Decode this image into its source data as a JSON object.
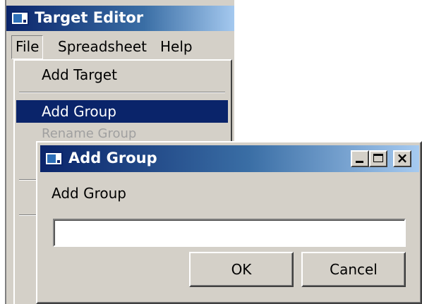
{
  "main_window": {
    "title": "Target Editor",
    "icon": "app-window-icon"
  },
  "menubar": {
    "items": [
      "File",
      "Spreadsheet",
      "Help"
    ]
  },
  "file_menu": {
    "items": [
      {
        "label": "Add Target",
        "state": "normal"
      },
      {
        "label": "Add Group",
        "state": "highlighted"
      },
      {
        "label": "Rename Group",
        "state": "disabled"
      }
    ]
  },
  "dialog": {
    "title": "Add Group",
    "icon": "app-window-icon",
    "prompt": "Add Group",
    "input_value": "",
    "ok_label": "OK",
    "cancel_label": "Cancel",
    "caption_buttons": [
      "minimize-icon",
      "maximize-icon",
      "close-icon"
    ],
    "close_glyph": "×"
  },
  "colors": {
    "titlebar_start": "#0a246a",
    "titlebar_end": "#a6caf0",
    "window_face": "#d4d0c8",
    "menu_highlight": "#0a246a",
    "disabled_text": "#a0a0a0"
  }
}
